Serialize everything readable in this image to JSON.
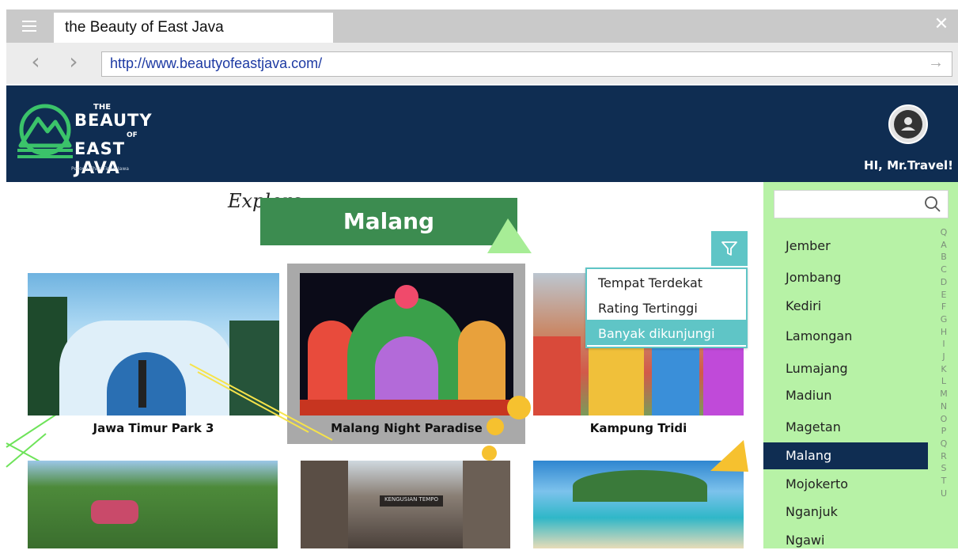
{
  "browser": {
    "tab_title": "the Beauty of East Java",
    "url": "http://www.beautyofeastjava.com/"
  },
  "header": {
    "logo": {
      "the": "THE",
      "beauty": "BEAUTY",
      "of": "OF",
      "east_java": "EAST JAVA",
      "tagline": "Pesona Khas Timur Jawa"
    },
    "greeting": "HI, Mr.Travel!"
  },
  "main": {
    "explore_label": "Explore",
    "city_title": "Malang",
    "filter_options": [
      "Tempat Terdekat",
      "Rating Tertinggi",
      "Banyak dikunjungi"
    ],
    "filter_selected": "Banyak dikunjungi",
    "cards": [
      {
        "title": "Jawa Timur Park 3"
      },
      {
        "title": "Malang Night Paradise"
      },
      {
        "title": "Kampung Tridi"
      }
    ],
    "second_row_signs": [
      "KENGUSIAN TEMPO"
    ]
  },
  "sidebar": {
    "search_placeholder": "",
    "cities": [
      "Jember",
      "Jombang",
      "Kediri",
      "Lamongan",
      "Lumajang",
      "Madiun",
      "Magetan",
      "Malang",
      "Mojokerto",
      "Nganjuk",
      "Ngawi"
    ],
    "selected_city": "Malang",
    "alphabet": [
      "Q",
      "A",
      "B",
      "C",
      "D",
      "E",
      "F",
      "G",
      "H",
      "I",
      "J",
      "K",
      "L",
      "M",
      "N",
      "O",
      "P",
      "Q",
      "R",
      "S",
      "T",
      "U"
    ]
  },
  "colors": {
    "navy": "#0f2d52",
    "green_banner": "#3c8c50",
    "light_green": "#b7f2a6",
    "teal": "#5fc5c6",
    "accent_yellow": "#f6c12f"
  }
}
